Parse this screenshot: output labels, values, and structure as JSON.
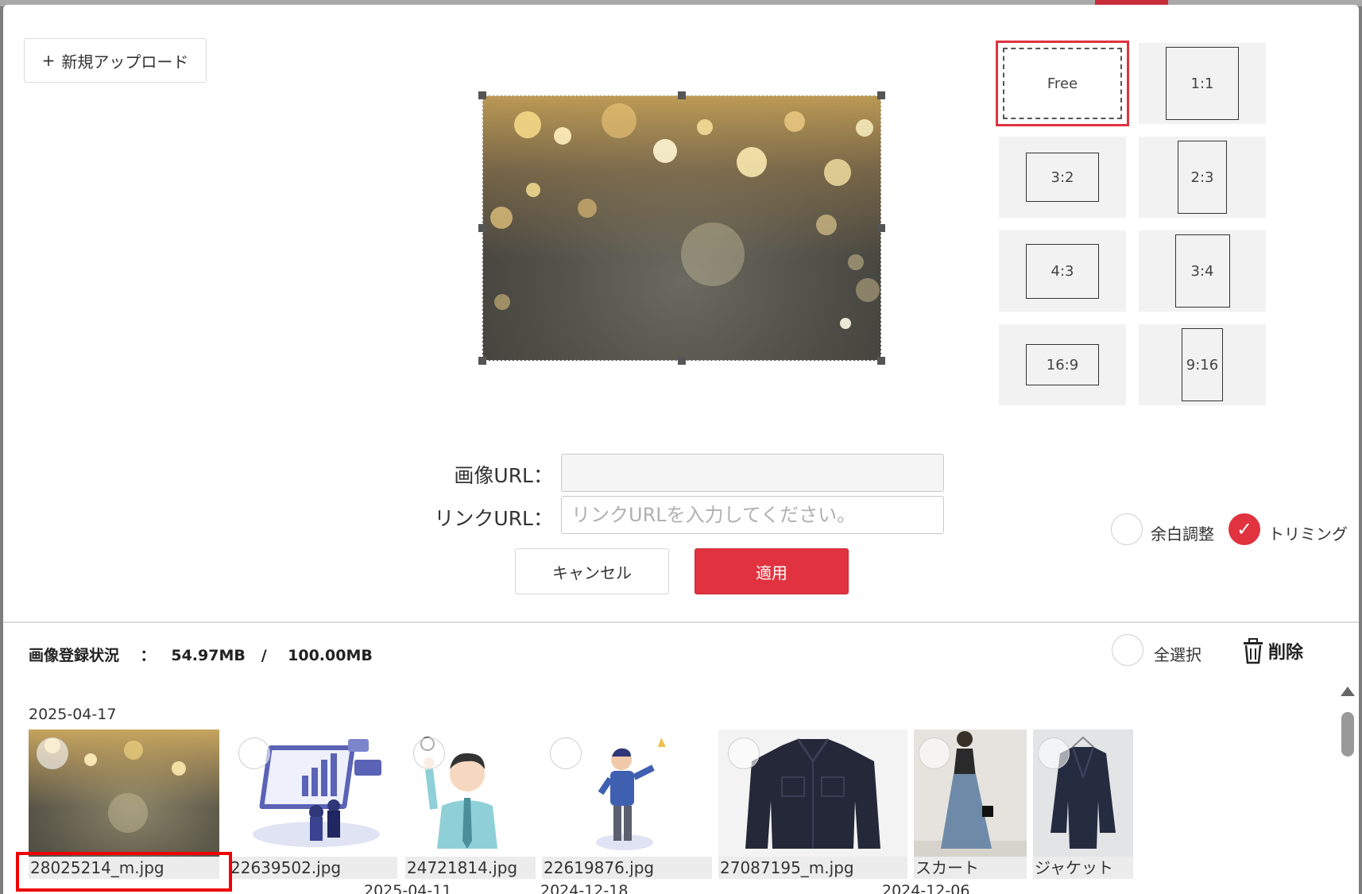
{
  "upload": {
    "icon": "plus-icon",
    "plus": "+",
    "label": "新規アップロード"
  },
  "ratios": [
    {
      "label": "Free",
      "selected": true
    },
    {
      "label": "1:1",
      "selected": false
    },
    {
      "label": "3:2",
      "selected": false
    },
    {
      "label": "2:3",
      "selected": false
    },
    {
      "label": "4:3",
      "selected": false
    },
    {
      "label": "3:4",
      "selected": false
    },
    {
      "label": "16:9",
      "selected": false
    },
    {
      "label": "9:16",
      "selected": false
    }
  ],
  "form": {
    "image_url_label": "画像URL：",
    "image_url_value": "",
    "link_url_label": "リンクURL：",
    "link_url_placeholder": "リンクURLを入力してください。"
  },
  "buttons": {
    "cancel": "キャンセル",
    "apply": "適用"
  },
  "options": {
    "margin_adjust": {
      "label": "余白調整",
      "checked": false
    },
    "trimming": {
      "label": "トリミング",
      "checked": true,
      "check_mark": "✓"
    }
  },
  "status": {
    "label": "画像登録状況",
    "separator": "：",
    "used": "54.97MB",
    "slash": "/",
    "total": "100.00MB"
  },
  "select_all": "全選択",
  "delete": {
    "label": "削除",
    "icon": "trash-icon"
  },
  "dates": [
    "2025-04-17",
    "2025-04-11",
    "2024-12-18",
    "2024-12-06"
  ],
  "images": [
    {
      "name": "28025214_m.jpg"
    },
    {
      "name": "22639502.jpg"
    },
    {
      "name": "24721814.jpg"
    },
    {
      "name": "22619876.jpg"
    },
    {
      "name": "27087195_m.jpg"
    },
    {
      "name": "スカート"
    },
    {
      "name": "ジャケット"
    }
  ],
  "colors": {
    "accent": "#e0333f",
    "highlight": "#ee0000"
  }
}
